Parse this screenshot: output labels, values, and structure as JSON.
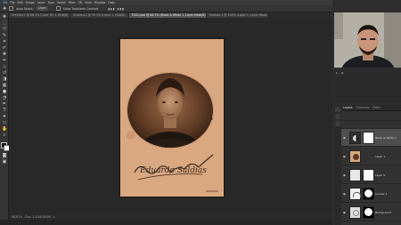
{
  "menubar": {
    "items": [
      "File",
      "Edit",
      "Image",
      "Layer",
      "Type",
      "Select",
      "Filter",
      "3D",
      "View",
      "Window",
      "Help"
    ]
  },
  "options": {
    "auto_select": "Auto-Select:",
    "layer_select": "Layer",
    "transform": "Show Transform Controls"
  },
  "tabs": [
    {
      "label": "Untitled-1 @ 66.7% (Color Fill 1, RGB/8)",
      "active": false
    },
    {
      "label": "Untitled-2 @ 33.3% (Layer 1, RGB/8)",
      "active": false
    },
    {
      "label": "TVOC.psd @ 66.7% (Black & White 1, Layer Mask/8)",
      "active": true
    },
    {
      "label": "Untitled-3 @ 100% (Layer 1, Layer Mask/8)",
      "active": false
    }
  ],
  "photo": {
    "signature": "Eduardo Saldias"
  },
  "status": {
    "zoom": "66.67%",
    "doc_size": "Doc: 2.41M/38.6M"
  },
  "layers_panel": {
    "tabs": [
      "Layers",
      "Channels",
      "Paths"
    ],
    "layers": [
      {
        "name": "Black & White 1",
        "selected": true
      },
      {
        "name": "Layer 1",
        "selected": false
      },
      {
        "name": "Layer 0",
        "selected": false
      },
      {
        "name": "Curves 1",
        "selected": false
      },
      {
        "name": "Background",
        "selected": false
      }
    ]
  },
  "colors": {
    "sepia": "#d9a880",
    "ui_dark": "#282828"
  }
}
